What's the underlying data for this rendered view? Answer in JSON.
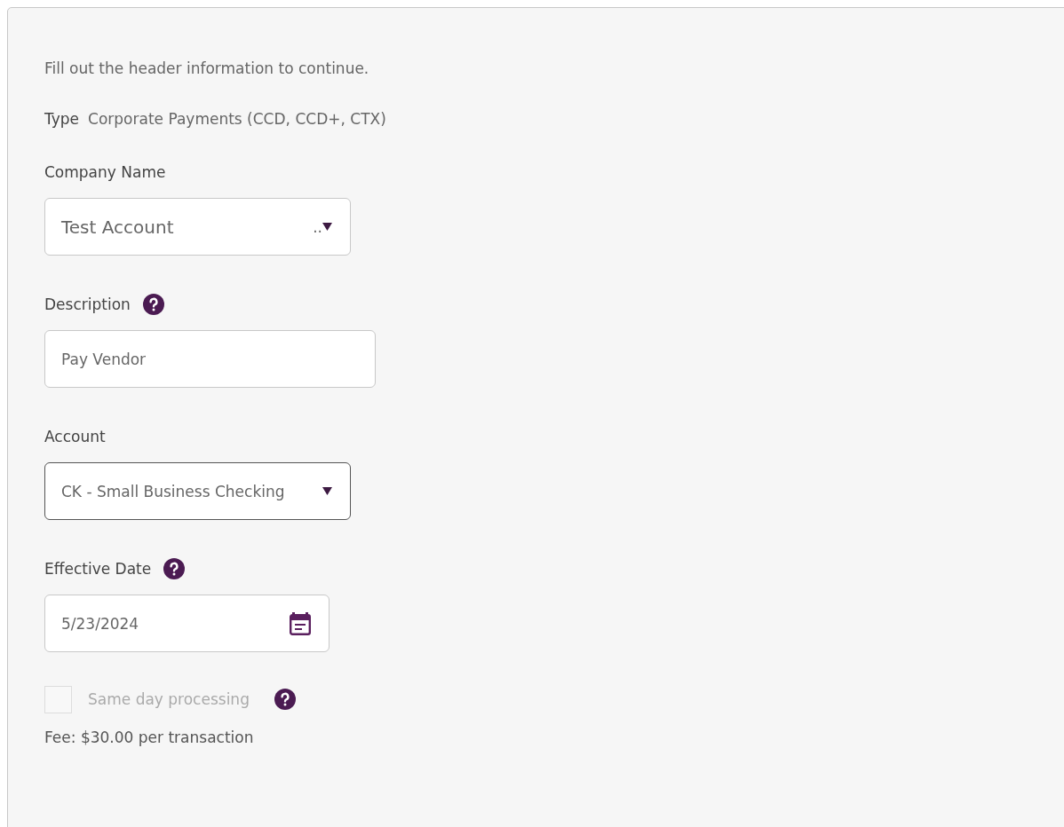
{
  "intro": "Fill out the header information to continue.",
  "type": {
    "label": "Type",
    "value": "Corporate Payments (CCD, CCD+, CTX)"
  },
  "fields": [
    {
      "kind": "select",
      "label": "Company Name",
      "value": "Test Account",
      "overflow": "..",
      "help": false,
      "focused": false
    },
    {
      "kind": "text",
      "label": "Description",
      "value": "Pay Vendor",
      "help": true,
      "focused": false
    },
    {
      "kind": "select",
      "label": "Account",
      "value": "CK - Small Business Checking",
      "help": false,
      "focused": true
    },
    {
      "kind": "date",
      "label": "Effective Date",
      "value": "5/23/2024",
      "help": true,
      "focused": false
    },
    {
      "kind": "checkbox",
      "label": "Same day processing",
      "checked": false,
      "disabled": true,
      "help": true
    }
  ],
  "fee": "Fee: $30.00 per transaction"
}
